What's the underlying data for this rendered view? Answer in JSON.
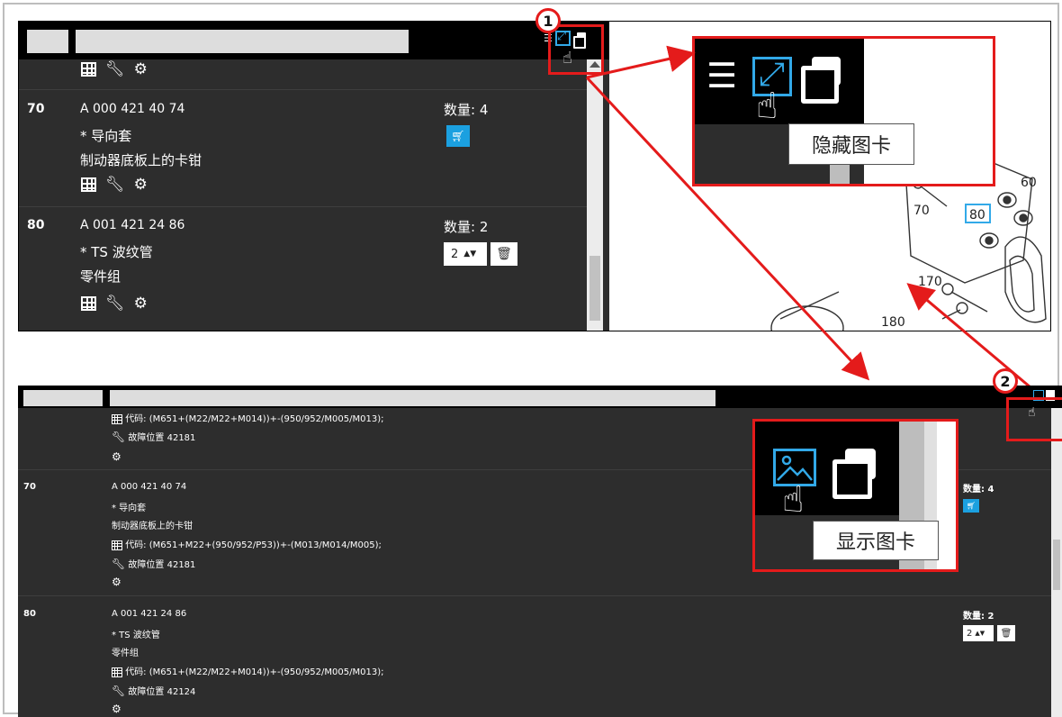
{
  "colors": {
    "accent_red": "#e41b1b",
    "accent_blue": "#32a9e8",
    "cart_blue": "#1ba0e0",
    "panel_dark": "#2d2d2d"
  },
  "markers": {
    "one": "1",
    "two": "2"
  },
  "tooltips": {
    "hide_card": "隐藏图卡",
    "show_card": "显示图卡"
  },
  "top_panel": {
    "items": [
      {
        "num": "70",
        "part_no": "A 000 421 40 74",
        "name": "* 导向套",
        "desc": "制动器底板上的卡钳",
        "qty_label": "数量:  4"
      },
      {
        "num": "80",
        "part_no": "A 001 421 24 86",
        "name": "* TS 波纹管",
        "desc": "零件组",
        "qty_label": "数量:  2",
        "stepper_value": "2"
      }
    ],
    "drawing_labels": [
      "60",
      "70",
      "80",
      "170",
      "180"
    ]
  },
  "bottom_panel": {
    "prev_code": "代码: (M651+(M22/M22+M014))+-(950/952/M005/M013);",
    "prev_fault": "故障位置 42181",
    "items": [
      {
        "num": "70",
        "part_no": "A 000 421 40 74",
        "name": "* 导向套",
        "desc": "制动器底板上的卡钳",
        "code": "代码: (M651+M22+(950/952/P53))+-(M013/M014/M005);",
        "fault": "故障位置 42181",
        "qty_label": "数量:  4"
      },
      {
        "num": "80",
        "part_no": "A 001 421 24 86",
        "name": "* TS 波纹管",
        "desc": "零件组",
        "code": "代码: (M651+(M22/M22+M014))+-(950/952/M005/M013);",
        "fault": "故障位置 42124",
        "qty_label": "数量:  2",
        "stepper_value": "2"
      }
    ]
  }
}
